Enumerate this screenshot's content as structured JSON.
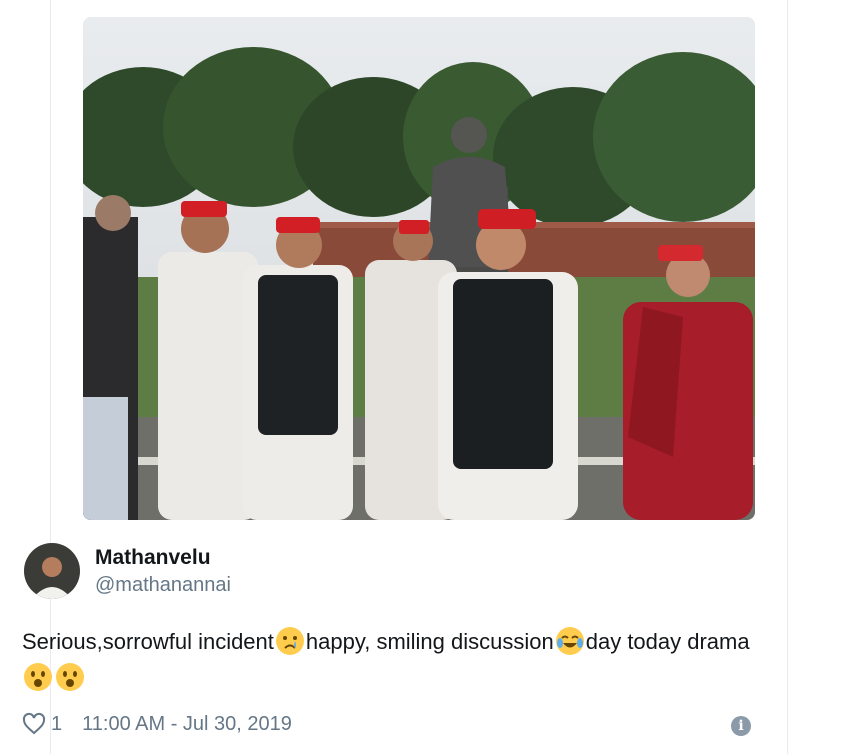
{
  "tweet": {
    "photo_label": "tweet-photo",
    "author": {
      "name": "Mathanvelu",
      "handle": "@mathanannai"
    },
    "text_parts": {
      "part1": "Serious,sorrowful incident",
      "part2": "happy, smiling discussion",
      "part3": "day today drama"
    },
    "emojis": [
      "crying-face-icon",
      "tears-of-joy-icon",
      "astonished-face-icon",
      "astonished-face-icon"
    ],
    "likes": "1",
    "timestamp": "11:00 AM - Jul 30, 2019",
    "icons": {
      "like": "heart-icon",
      "info": "info-icon"
    }
  },
  "colors": {
    "text": "#14171a",
    "muted": "#657786",
    "divider": "#e6ecf0"
  }
}
